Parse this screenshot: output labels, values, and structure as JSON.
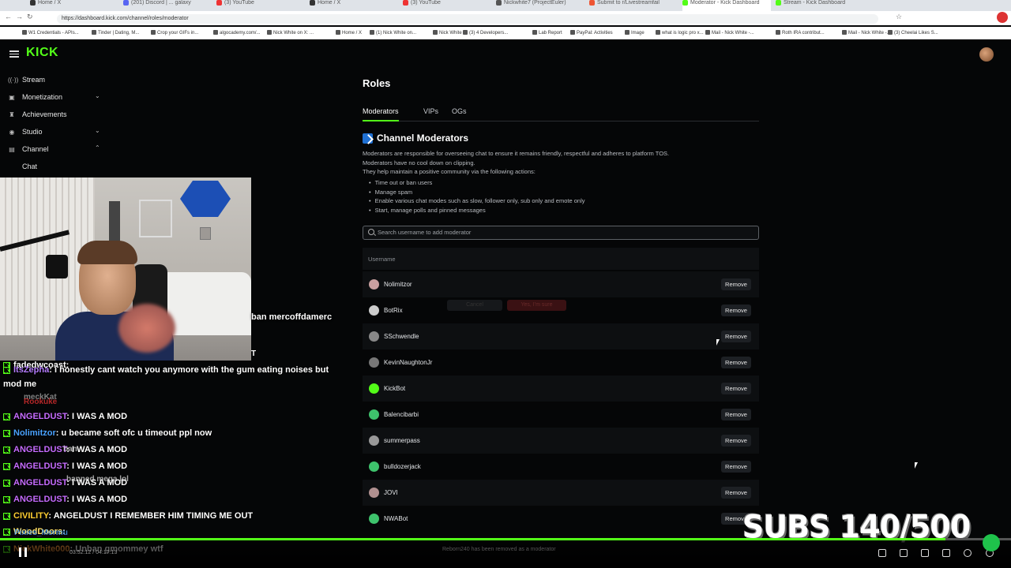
{
  "browser": {
    "tabs": [
      {
        "label": "Home / X",
        "color": "#333"
      },
      {
        "label": "(201) Discord | ... galaxy",
        "color": "#5865f2"
      },
      {
        "label": "(3) YouTube",
        "color": "#e33"
      },
      {
        "label": "Home / X",
        "color": "#333"
      },
      {
        "label": "(3) YouTube",
        "color": "#e33"
      },
      {
        "label": "Nickwhite7 (ProjectEuler)",
        "color": "#555"
      },
      {
        "label": "Submit to r/Livestreamfail",
        "color": "#e53"
      },
      {
        "label": "Moderator - Kick Dashboard",
        "color": "#53fc18"
      },
      {
        "label": "Stream - Kick Dashboard",
        "color": "#53fc18"
      }
    ],
    "url": "https://dashboard.kick.com/channel/roles/moderator",
    "bookmarks": [
      "W1 Credentials - APIs...",
      "Tinder | Dating, M...",
      "Crop your GIFs in...",
      "algocademy.com/...",
      "Nick White on X: ...",
      "Home / X",
      "(1) Nick White on...",
      "Nick White",
      "(3) 4 Developers...",
      "Lab Report",
      "PayPal: Activities",
      "Image",
      "what is logic pro x...",
      "Mail - Nick White -...",
      "Roth IRA contribut...",
      "Mail - Nick White -...",
      "(3) Cheelai Likes S..."
    ]
  },
  "header": {
    "logo": "KICK"
  },
  "sidebar": {
    "items": [
      {
        "label": "Stream",
        "icon": "broadcast-icon",
        "glyph": "((·))"
      },
      {
        "label": "Monetization",
        "icon": "wallet-icon",
        "glyph": "▣",
        "chevron": "⌄"
      },
      {
        "label": "Achievements",
        "icon": "trophy-icon",
        "glyph": "♜"
      },
      {
        "label": "Studio",
        "icon": "studio-icon",
        "glyph": "◉",
        "chevron": "⌄"
      },
      {
        "label": "Channel",
        "icon": "channel-icon",
        "glyph": "▤",
        "chevron": "⌃"
      },
      {
        "label": "Chat",
        "icon": "",
        "glyph": ""
      }
    ]
  },
  "overlay": {
    "caption": "ban mercoffdamerc",
    "caption2": "T"
  },
  "chat": [
    {
      "user": "fadedwcoast",
      "userColor": "#ffffff",
      "text": ":"
    },
    {
      "user": "ItsZepha",
      "userColor": "#b57dff",
      "text": ": i honestly cant watch you anymore with the gum eating noises but"
    },
    {
      "user": "",
      "userColor": "#fff",
      "text": "mod me"
    },
    {
      "user": "ANGELDUST",
      "userColor": "#c66cff",
      "text": ": I WAS A MOD"
    },
    {
      "user": "Nolimitzor",
      "userColor": "#4aa3ff",
      "text": ": u became soft ofc u timeout ppl now"
    },
    {
      "user": "ANGELDUST",
      "userColor": "#c66cff",
      "text": ": I WAS A MOD"
    },
    {
      "user": "ANGELDUST",
      "userColor": "#c66cff",
      "text": ": I WAS A MOD"
    },
    {
      "user": "ANGELDUST",
      "userColor": "#c66cff",
      "text": ": I WAS A MOD"
    },
    {
      "user": "ANGELDUST",
      "userColor": "#c66cff",
      "text": ": I WAS A MOD"
    },
    {
      "user": "CIVILITY",
      "userColor": "#ffcf33",
      "text": ": ANGELDUST I REMEMBER HIM TIMING ME OUT"
    },
    {
      "user": "WoodDoors",
      "userColor": "#ffe066",
      "text": ":"
    },
    {
      "user": "NickWhite000",
      "userColor": "#ff9b3d",
      "text": ": Unban gmommey wtf"
    }
  ],
  "chat_ghosts": [
    "meckKat",
    "Rookuke",
    "ban",
    "banned mega lol",
    "Pixies_Mormu"
  ],
  "roles": {
    "title": "Roles",
    "tabs": [
      "Moderators",
      "VIPs",
      "OGs"
    ],
    "section_title": "Channel Moderators",
    "description": [
      "Moderators are responsible for overseeing chat to ensure it remains friendly, respectful and adheres to platform TOS.",
      "Moderators have no cool down on clipping.",
      "They help maintain a positive community via the following actions:"
    ],
    "bullets": [
      "Time out or ban users",
      "Manage spam",
      "Enable various chat modes such as slow, follower only, sub only and emote only",
      "Start, manage polls and pinned messages"
    ],
    "search_placeholder": "Search username to add moderator",
    "column_header": "Username",
    "remove_label": "Remove",
    "ghost_cancel": "Cancel",
    "ghost_confirm": "Yes, I'm sure",
    "moderators": [
      {
        "name": "Nolimitzor",
        "color": "#c9a0a0"
      },
      {
        "name": "BotRix",
        "color": "#cccccc"
      },
      {
        "name": "SSchwendle",
        "color": "#888888"
      },
      {
        "name": "KevinNaughtonJr",
        "color": "#777777"
      },
      {
        "name": "KickBot",
        "color": "#53fc18"
      },
      {
        "name": "Balencibarbi",
        "color": "#3ec26c"
      },
      {
        "name": "summerpass",
        "color": "#999999"
      },
      {
        "name": "bulldozerjack",
        "color": "#3ec26c"
      },
      {
        "name": "JOVI",
        "color": "#b09090"
      },
      {
        "name": "NWABot",
        "color": "#3ec26c"
      }
    ]
  },
  "player": {
    "time": "03:52:12 / 04:17:13",
    "toast": "Reborn240 has been removed as a moderator",
    "subs_goal": "SUBS 140/500",
    "progress": 0.935
  }
}
